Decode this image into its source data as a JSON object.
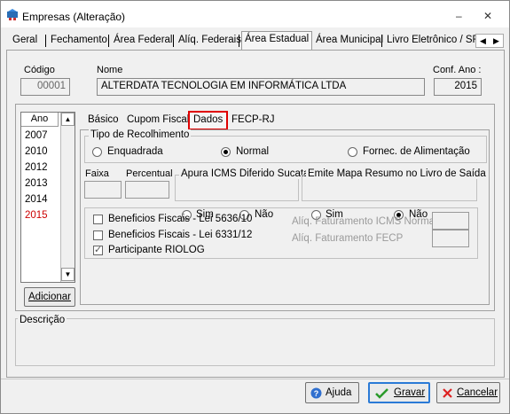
{
  "window": {
    "title": "Empresas (Alteração)",
    "minimize": "–",
    "close": "✕"
  },
  "tabs": [
    "Geral",
    "Fechamento",
    "Área Federal",
    "Alíq. Federais",
    "Área Estadual",
    "Área Municipal",
    "Livro Eletrônico / SF"
  ],
  "tab_scroll": {
    "left": "◀",
    "right": "▶"
  },
  "company": {
    "codigo_label": "Código",
    "codigo_value": "00001",
    "nome_label": "Nome",
    "nome_value": "ALTERDATA TECNOLOGIA EM INFORMÁTICA LTDA",
    "conf_ano_label": "Conf. Ano :",
    "conf_ano_value": "2015"
  },
  "years": {
    "header": "Ano",
    "items": [
      "2007",
      "2010",
      "2012",
      "2013",
      "2014",
      "2015"
    ],
    "selected": "2015"
  },
  "adicionar_label": "Adicionar",
  "subtabs": [
    "Básico",
    "Cupom Fiscal",
    "Dados",
    "FECP-RJ"
  ],
  "tipo_recolhimento": {
    "title": "Tipo de Recolhimento",
    "options": [
      "Enquadrada",
      "Normal",
      "Fornec. de Alimentação"
    ],
    "selected": "Normal"
  },
  "faixa_label": "Faixa",
  "percentual_label": "Percentual",
  "apura_icms": {
    "title": "Apura ICMS Diferido Sucata",
    "sim": "Sim",
    "nao": "Não",
    "selected": "none"
  },
  "emite_mapa": {
    "title": "Emite Mapa Resumo no Livro de Saída",
    "sim": "Sim",
    "nao": "Não",
    "selected": "Não"
  },
  "beneficios": {
    "lei5636": "Beneficios Fiscais - Lei 5636/10",
    "lei6331": "Beneficios Fiscais - Lei 6331/12",
    "riolog": "Participante RIOLOG",
    "aliq_icms_normal": "Alíq. Faturamento ICMS Normal",
    "aliq_fecp": "Alíq. Faturamento FECP"
  },
  "descricao_label": "Descrição",
  "buttons": {
    "ajuda": "Ajuda",
    "gravar": "Gravar",
    "cancelar": "Cancelar"
  },
  "colors": {
    "highlight_red": "#e00000",
    "selected_year": "#cc0000"
  }
}
